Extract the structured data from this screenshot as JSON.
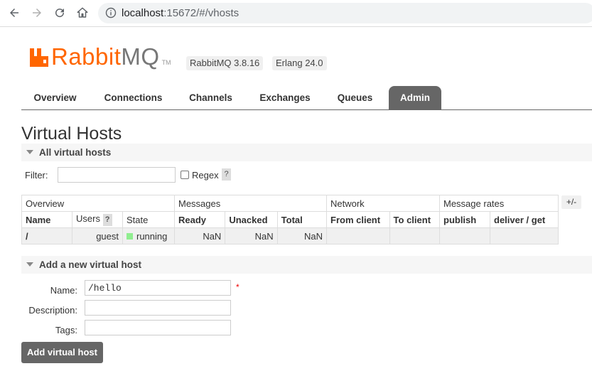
{
  "browser": {
    "url_host": "localhost",
    "url_rest": ":15672/#/vhosts"
  },
  "logo": {
    "rabbit": "Rabbit",
    "mq": "MQ",
    "tm": "TM"
  },
  "badges": {
    "rabbitmq_version": "RabbitMQ 3.8.16",
    "erlang_version": "Erlang 24.0"
  },
  "tabs": [
    {
      "label": "Overview"
    },
    {
      "label": "Connections"
    },
    {
      "label": "Channels"
    },
    {
      "label": "Exchanges"
    },
    {
      "label": "Queues"
    },
    {
      "label": "Admin"
    }
  ],
  "page_title": "Virtual Hosts",
  "all_vhosts": {
    "section_label": "All virtual hosts",
    "filter_label": "Filter:",
    "filter_value": "",
    "regex_label": "Regex",
    "help": "?",
    "plus_minus": "+/-",
    "group_headers": [
      "Overview",
      "Messages",
      "Network",
      "Message rates"
    ],
    "columns": [
      "Name",
      "Users",
      "State",
      "Ready",
      "Unacked",
      "Total",
      "From client",
      "To client",
      "publish",
      "deliver / get"
    ],
    "rows": [
      {
        "name": "/",
        "users": "guest",
        "state": "running",
        "ready": "NaN",
        "unacked": "NaN",
        "total": "NaN",
        "from_client": "",
        "to_client": "",
        "publish": "",
        "deliver_get": ""
      }
    ]
  },
  "add_vhost": {
    "section_label": "Add a new virtual host",
    "name_label": "Name:",
    "name_value": "/hello",
    "required_mark": "*",
    "description_label": "Description:",
    "description_value": "",
    "tags_label": "Tags:",
    "tags_value": "",
    "submit_label": "Add virtual host"
  },
  "colors": {
    "brand_orange": "#ff6600",
    "tab_active": "#666666",
    "running": "#90ee90"
  }
}
